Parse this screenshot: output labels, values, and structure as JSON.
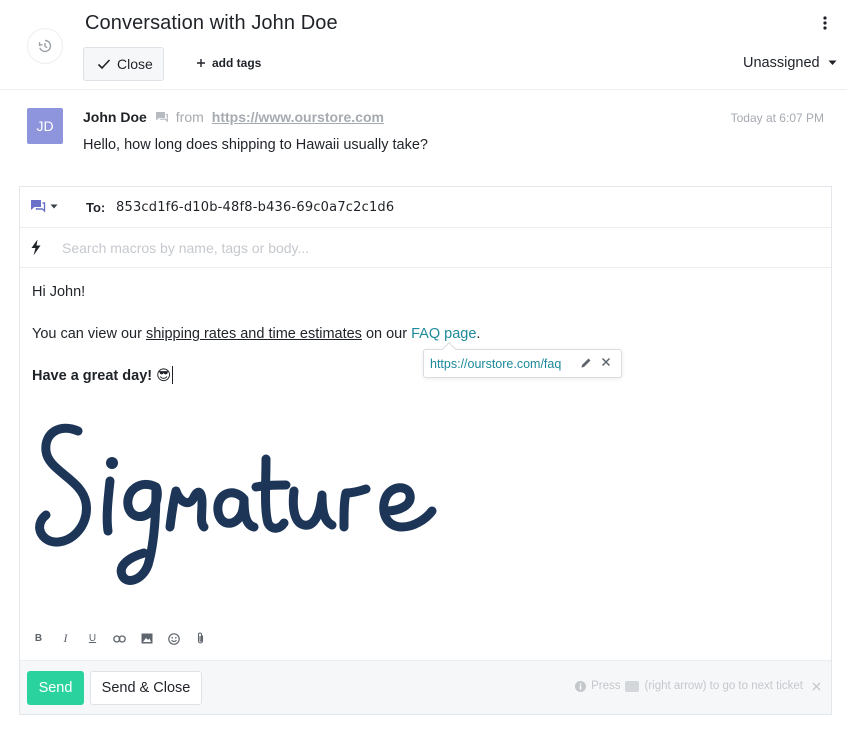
{
  "header": {
    "title": "Conversation with John Doe",
    "close_label": "Close",
    "add_tags_label": "add tags",
    "assignee": "Unassigned"
  },
  "message": {
    "avatar_initials": "JD",
    "sender": "John Doe",
    "from_label": "from",
    "from_url": "https://www.ourstore.com",
    "time": "Today at 6:07 PM",
    "body": "Hello, how long does shipping to Hawaii usually take?"
  },
  "composer": {
    "to_label": "To:",
    "to_value": "853cd1f6-d10b-48f8-b436-69c0a7c2c1d6",
    "macro_placeholder": "Search macros by name, tags or body...",
    "greeting": "Hi John!",
    "line2_prefix": "You can view our ",
    "line2_link": "shipping rates and time estimates",
    "line2_mid": " on our ",
    "line2_faq": "FAQ page",
    "line2_suffix": ".",
    "closing": "Have a great day! 😎",
    "link_popup_url": "https://ourstore.com/faq",
    "signature_alt": "Signature"
  },
  "toolbar": {
    "bold": "B",
    "italic": "I",
    "underline": "U"
  },
  "footer": {
    "send_label": "Send",
    "send_close_label": "Send & Close",
    "hint_prefix": "Press",
    "hint_suffix": "(right arrow) to go to next ticket"
  },
  "colors": {
    "accent_green": "#2ad39d",
    "avatar": "#8f95dd",
    "link": "#1c8a9a",
    "signature": "#1d3557"
  },
  "icons": [
    "history-icon",
    "kebab-menu-icon",
    "check-icon",
    "plus-icon",
    "caret-down-icon",
    "chat-icon",
    "bolt-icon",
    "pencil-icon",
    "close-icon",
    "link-icon",
    "image-icon",
    "emoji-icon",
    "attachment-icon",
    "info-icon"
  ]
}
